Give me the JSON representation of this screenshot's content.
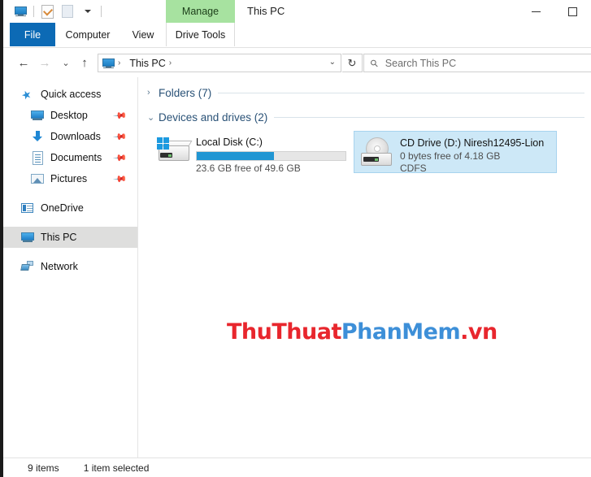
{
  "window": {
    "title": "This PC",
    "contextual_header": "Manage",
    "minimize_label": "Minimize",
    "maximize_label": "Maximize"
  },
  "quick_access_toolbar": {
    "items": [
      {
        "name": "properties-pc-icon",
        "label": "This PC"
      },
      {
        "name": "properties-icon",
        "label": "Properties"
      },
      {
        "name": "new-folder-icon",
        "label": "New folder"
      },
      {
        "name": "customize-dropdown-icon",
        "label": "Customize Quick Access Toolbar"
      }
    ]
  },
  "ribbon": {
    "tabs": [
      {
        "label": "File",
        "active": true
      },
      {
        "label": "Computer",
        "active": false
      },
      {
        "label": "View",
        "active": false
      },
      {
        "label": "Drive Tools",
        "active": false
      }
    ]
  },
  "address_bar": {
    "back_glyph": "←",
    "forward_glyph": "→",
    "recent_glyph": "⌄",
    "up_glyph": "↑",
    "breadcrumb": [
      "This PC"
    ],
    "separator": "›",
    "dropdown_glyph": "⌄",
    "refresh_glyph": "↻"
  },
  "search": {
    "placeholder": "Search This PC",
    "icon": "search-icon",
    "value": ""
  },
  "sidebar": {
    "items": [
      {
        "label": "Quick access",
        "icon": "pin-star-icon",
        "indent": false,
        "pinned": false,
        "selected": false
      },
      {
        "label": "Desktop",
        "icon": "desktop-icon",
        "indent": true,
        "pinned": true,
        "selected": false
      },
      {
        "label": "Downloads",
        "icon": "downloads-icon",
        "indent": true,
        "pinned": true,
        "selected": false
      },
      {
        "label": "Documents",
        "icon": "documents-icon",
        "indent": true,
        "pinned": true,
        "selected": false
      },
      {
        "label": "Pictures",
        "icon": "pictures-icon",
        "indent": true,
        "pinned": true,
        "selected": false
      },
      {
        "label": "OneDrive",
        "icon": "onedrive-icon",
        "indent": false,
        "pinned": false,
        "selected": false
      },
      {
        "label": "This PC",
        "icon": "this-pc-icon",
        "indent": false,
        "pinned": false,
        "selected": true
      },
      {
        "label": "Network",
        "icon": "network-icon",
        "indent": false,
        "pinned": false,
        "selected": false
      }
    ],
    "pin_glyph": "📌"
  },
  "content": {
    "groups": [
      {
        "title": "Folders (7)",
        "expanded": false,
        "chevron": "›"
      },
      {
        "title": "Devices and drives (2)",
        "expanded": true,
        "chevron": "⌄"
      }
    ],
    "drives": [
      {
        "name": "Local Disk (C:)",
        "icon": "hard-drive-icon",
        "capacity_text": "23.6 GB free of 49.6 GB",
        "extra_text": "",
        "used_percent": 52,
        "selected": false,
        "bar_color": "#2196d3"
      },
      {
        "name": "CD Drive (D:) Niresh12495-Lion",
        "icon": "cd-drive-icon",
        "capacity_text": "0 bytes free of 4.18 GB",
        "extra_text": "CDFS",
        "used_percent": 100,
        "selected": true,
        "bar_color": "#2196d3"
      }
    ]
  },
  "watermark": {
    "part1": "ThuThuat",
    "part2": "PhanMem",
    "part3": ".vn",
    "color1": "#e8262d",
    "color2": "#3d8fd8"
  },
  "statusbar": {
    "item_count": "9 items",
    "selection": "1 item selected"
  }
}
